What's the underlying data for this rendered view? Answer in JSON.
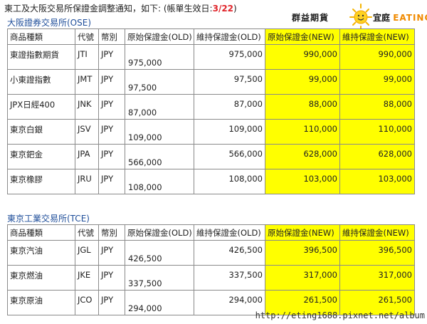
{
  "notice": {
    "text": "東工及大阪交易所保證金調整通知，如下: (帳單生效日:",
    "date": "3/22",
    "close": ")"
  },
  "logo": {
    "left_text": "群益期貨",
    "right_cn": "宜庭",
    "right_en": "EATING"
  },
  "colors": {
    "highlight": "#ffff00",
    "section_title": "#1f4e9a",
    "date_red": "#e0242a"
  },
  "ose": {
    "title": "大阪證券交易所(OSE)",
    "headers": [
      "商品種類",
      "代號",
      "幣別",
      "原始保證金(OLD)",
      "維持保證金(OLD)",
      "原始保證金(NEW)",
      "維持保證金(NEW)"
    ],
    "rows": [
      [
        "東證指數期貨",
        "JTI",
        "JPY",
        "975,000",
        "975,000",
        "990,000",
        "990,000"
      ],
      [
        "小東證指數",
        "JMT",
        "JPY",
        "97,500",
        "97,500",
        "99,000",
        "99,000"
      ],
      [
        "JPX日經400",
        "JNK",
        "JPY",
        "87,000",
        "87,000",
        "88,000",
        "88,000"
      ],
      [
        "東京白銀",
        "JSV",
        "JPY",
        "109,000",
        "109,000",
        "110,000",
        "110,000"
      ],
      [
        "東京鈀金",
        "JPA",
        "JPY",
        "566,000",
        "566,000",
        "628,000",
        "628,000"
      ],
      [
        "東京橡膠",
        "JRU",
        "JPY",
        "108,000",
        "108,000",
        "103,000",
        "103,000"
      ]
    ]
  },
  "tce": {
    "title": "東京工業交易所(TCE)",
    "headers": [
      "商品種類",
      "代號",
      "幣別",
      "原始保證金(OLD)",
      "維持保證金(OLD)",
      "原始保證金(NEW)",
      "維持保證金(NEW)"
    ],
    "rows": [
      [
        "東京汽油",
        "JGL",
        "JPY",
        "426,500",
        "426,500",
        "396,500",
        "396,500"
      ],
      [
        "東京燃油",
        "JKE",
        "JPY",
        "337,500",
        "337,500",
        "317,000",
        "317,000"
      ],
      [
        "東京原油",
        "JCO",
        "JPY",
        "294,000",
        "294,000",
        "261,500",
        "261,500"
      ]
    ]
  },
  "watermark": "http://eting1688.pixnet.net/album"
}
